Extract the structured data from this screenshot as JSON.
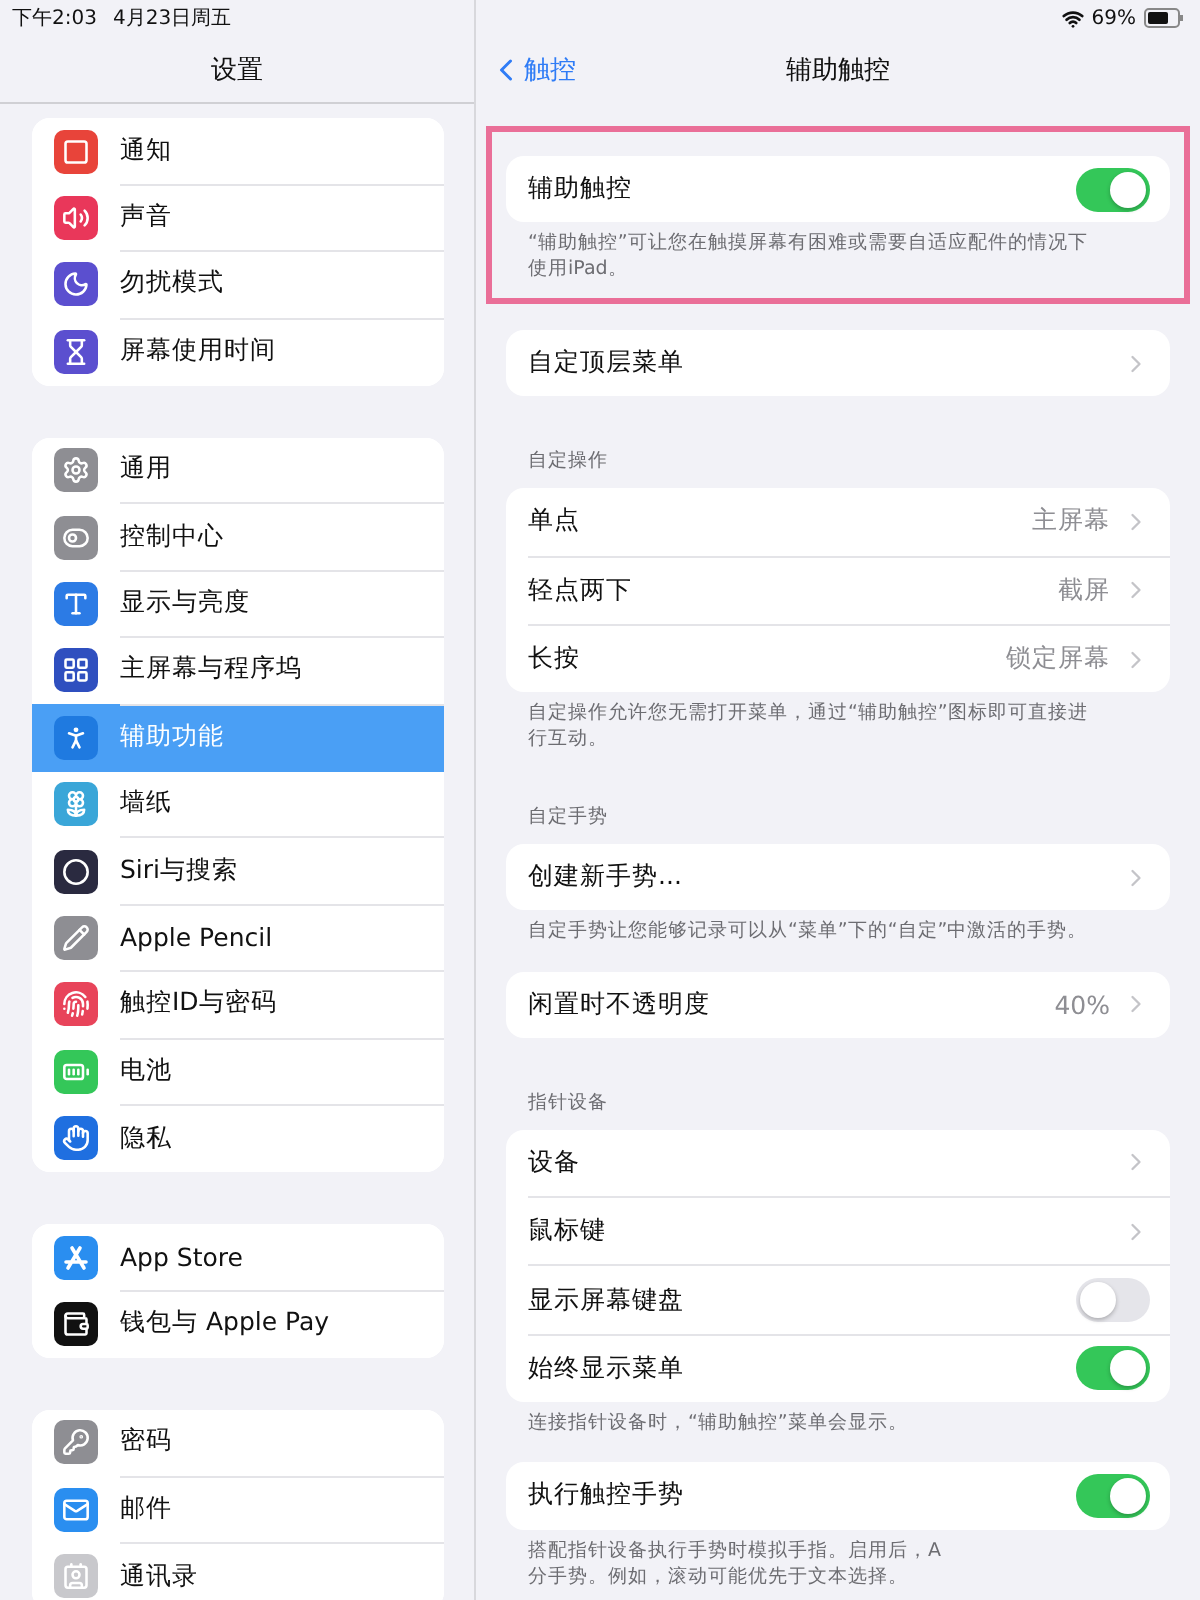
{
  "status_bar": {
    "time": "下午2:03",
    "date": "4月23日周五",
    "battery": "69%"
  },
  "sidebar": {
    "title": "设置",
    "groups": [
      {
        "items": [
          {
            "label": "通知",
            "color": "#e8443a",
            "selected": false
          },
          {
            "label": "声音",
            "color": "#e9375a",
            "selected": false
          },
          {
            "label": "勿扰模式",
            "color": "#5b4fcf",
            "selected": false
          },
          {
            "label": "屏幕使用时间",
            "color": "#5b4fcf",
            "selected": false
          }
        ]
      },
      {
        "items": [
          {
            "label": "通用",
            "color": "#8e8e93",
            "selected": false
          },
          {
            "label": "控制中心",
            "color": "#8e8e93",
            "selected": false
          },
          {
            "label": "显示与亮度",
            "color": "#2c7be5",
            "selected": false
          },
          {
            "label": "主屏幕与程序坞",
            "color": "#2f4fbf",
            "selected": false
          },
          {
            "label": "辅助功能",
            "color": "#1f7ae0",
            "selected": true
          },
          {
            "label": "墙纸",
            "color": "#3aa6d8",
            "selected": false
          },
          {
            "label": "Siri与搜索",
            "color": "#2a2a40",
            "selected": false
          },
          {
            "label": "Apple Pencil",
            "color": "#8e8e93",
            "selected": false
          },
          {
            "label": "触控ID与密码",
            "color": "#e8445a",
            "selected": false
          },
          {
            "label": "电池",
            "color": "#34c759",
            "selected": false
          },
          {
            "label": "隐私",
            "color": "#1f6fe0",
            "selected": false
          }
        ]
      },
      {
        "items": [
          {
            "label": "App Store",
            "color": "#2a8ef0",
            "selected": false
          },
          {
            "label": "钱包与 Apple Pay",
            "color": "#111111",
            "selected": false
          }
        ]
      },
      {
        "items": [
          {
            "label": "密码",
            "color": "#8e8e93",
            "selected": false
          },
          {
            "label": "邮件",
            "color": "#2a8ef0",
            "selected": false
          },
          {
            "label": "通讯录",
            "color": "#c8c8cc",
            "selected": false
          }
        ]
      }
    ]
  },
  "nav": {
    "back": "触控",
    "title": "辅助触控"
  },
  "sections": [
    {
      "highlighted": true,
      "rows": [
        {
          "kind": "toggle",
          "label": "辅助触控",
          "on": true
        }
      ],
      "footer": "“辅助触控”可让您在触摸屏幕有困难或需要自适应配件的情况下使用iPad。"
    },
    {
      "highlighted": false,
      "rows": [
        {
          "kind": "link",
          "label": "自定顶层菜单"
        }
      ]
    },
    {
      "highlighted": false,
      "header": "自定操作",
      "rows": [
        {
          "kind": "link",
          "label": "单点",
          "value": "主屏幕"
        },
        {
          "kind": "link",
          "label": "轻点两下",
          "value": "截屏"
        },
        {
          "kind": "link",
          "label": "长按",
          "value": "锁定屏幕"
        }
      ],
      "footer": "自定操作允许您无需打开菜单，通过“辅助触控”图标即可直接进行互动。"
    },
    {
      "highlighted": false,
      "header": "自定手势",
      "rows": [
        {
          "kind": "link",
          "label": "创建新手势..."
        }
      ],
      "footer": "自定手势让您能够记录可以从“菜单”下的“自定”中激活的手势。"
    },
    {
      "highlighted": false,
      "rows": [
        {
          "kind": "link",
          "label": "闲置时不透明度",
          "value": "40%"
        }
      ]
    },
    {
      "highlighted": false,
      "header": "指针设备",
      "rows": [
        {
          "kind": "link",
          "label": "设备"
        },
        {
          "kind": "link",
          "label": "鼠标键"
        },
        {
          "kind": "toggle",
          "label": "显示屏幕键盘",
          "on": false
        },
        {
          "kind": "toggle",
          "label": "始终显示菜单",
          "on": true
        }
      ],
      "footer": "连接指针设备时，“辅助触控”菜单会显示。"
    },
    {
      "highlighted": false,
      "rows": [
        {
          "kind": "toggle",
          "label": "执行触控手势",
          "on": true
        }
      ],
      "footer_lines": [
        "搭配指针设备执行手势时模拟手指。启用后，A",
        "分手势。例如，滚动可能优先于文本选择。"
      ]
    }
  ]
}
